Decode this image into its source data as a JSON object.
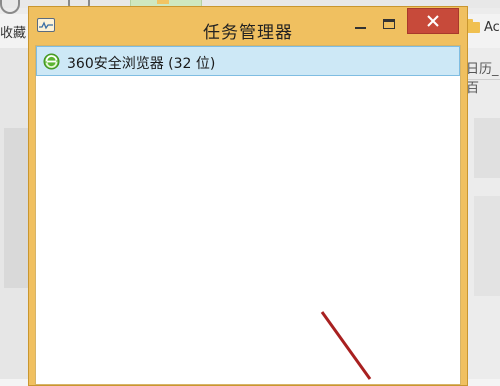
{
  "background_browser": {
    "bookmark_left_text": "收藏",
    "bookmark_right_text": "Ac",
    "right_panel_text": "日历_百"
  },
  "task_manager": {
    "title": "任务管理器",
    "app_icon": "task-manager-icon",
    "close_icon": "close-x-icon",
    "processes": [
      {
        "label": "360安全浏览器 (32 位)",
        "icon": "360-browser-icon",
        "selected": true
      }
    ],
    "colors": {
      "frame": "#f0c060",
      "close_button": "#c74a3a",
      "selected_row": "#cde8f6",
      "selected_border": "#7fbde2"
    }
  },
  "annotation": {
    "arrow_color": "#a82020"
  }
}
